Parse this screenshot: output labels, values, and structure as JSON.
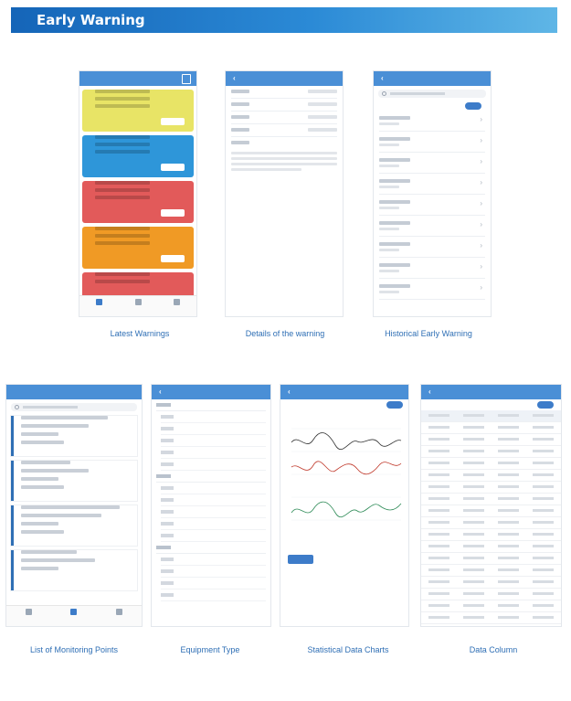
{
  "banner": {
    "title": "Early Warning"
  },
  "captions": {
    "latest_warnings": "Latest Warnings",
    "details_of_warning": "Details of the warning",
    "historical_early_warning": "Historical Early Warning",
    "list_of_monitoring_points": "List of Monitoring Points",
    "equipment_type": "Equipment Type",
    "statistical_data_charts": "Statistical Data Charts",
    "data_column": "Data Column"
  },
  "card_colors": [
    "#e8e466",
    "#2e96d9",
    "#e25a5a",
    "#f09a25",
    "#e25a5a"
  ],
  "chart_colors": {
    "line1": "#333333",
    "line2": "#c0392b",
    "line3": "#2e8b57"
  }
}
